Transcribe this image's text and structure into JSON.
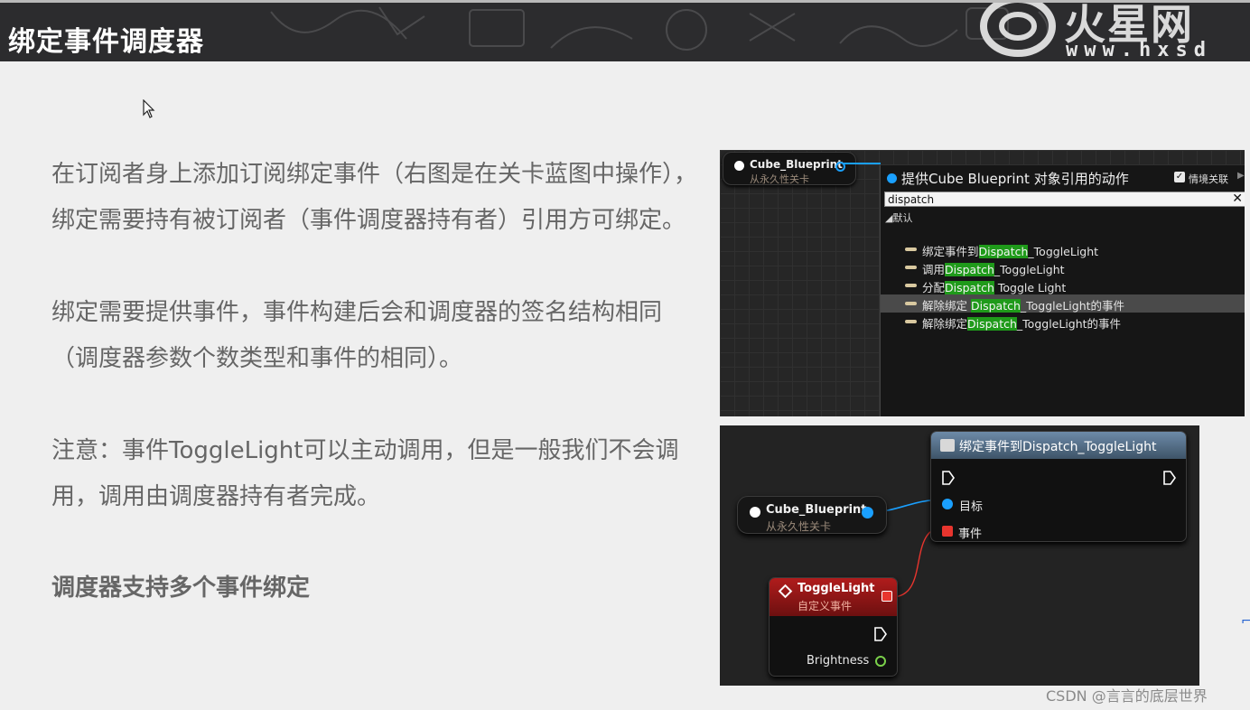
{
  "header": {
    "title": "绑定事件调度器",
    "logo_glyphs": "火星网",
    "logo_url": "www.hxsd"
  },
  "paragraphs": {
    "p1": "在订阅者身上添加订阅绑定事件（右图是在关卡蓝图中操作），绑定需要持有被订阅者（事件调度器持有者）引用方可绑定。",
    "p2": "绑定需要提供事件，事件构建后会和调度器的签名结构相同（调度器参数个数类型和事件的相同）。",
    "p3": "注意：事件ToggleLight可以主动调用，但是一般我们不会调用，调用由调度器持有者完成。",
    "p4": "调度器支持多个事件绑定"
  },
  "screenshot_top": {
    "node_title": "Cube_Blueprint",
    "node_subtitle": "从永久性关卡",
    "menu_title": "提供Cube Blueprint 对象引用的动作",
    "context_label": "情境关联",
    "search_value": "dispatch",
    "category": "默认",
    "items": [
      {
        "pre": "绑定事件到",
        "hl": "Dispatch",
        "post": "_ToggleLight"
      },
      {
        "pre": "调用",
        "hl": "Dispatch",
        "post": "_ToggleLight"
      },
      {
        "pre": "分配",
        "hl": "Dispatch",
        "post": " Toggle Light"
      },
      {
        "pre": "解除绑定 ",
        "hl": "Dispatch",
        "post": "_ToggleLight的事件"
      },
      {
        "pre": "解除绑定",
        "hl": "Dispatch",
        "post": "_ToggleLight的事件"
      }
    ]
  },
  "screenshot_bottom": {
    "bind_node_title": "绑定事件到Dispatch_ToggleLight",
    "target_label": "目标",
    "event_label": "事件",
    "cube_title": "Cube_Blueprint",
    "cube_subtitle": "从永久性关卡",
    "toggle_title": "ToggleLight",
    "toggle_subtitle": "自定义事件",
    "brightness_label": "Brightness"
  },
  "watermark": "CSDN @言言的底层世界",
  "colors": {
    "highlight": "#1f9a1a",
    "object_pin": "#1aa0ff",
    "delegate_pin": "#e8352e",
    "float_pin": "#7ad04a"
  }
}
